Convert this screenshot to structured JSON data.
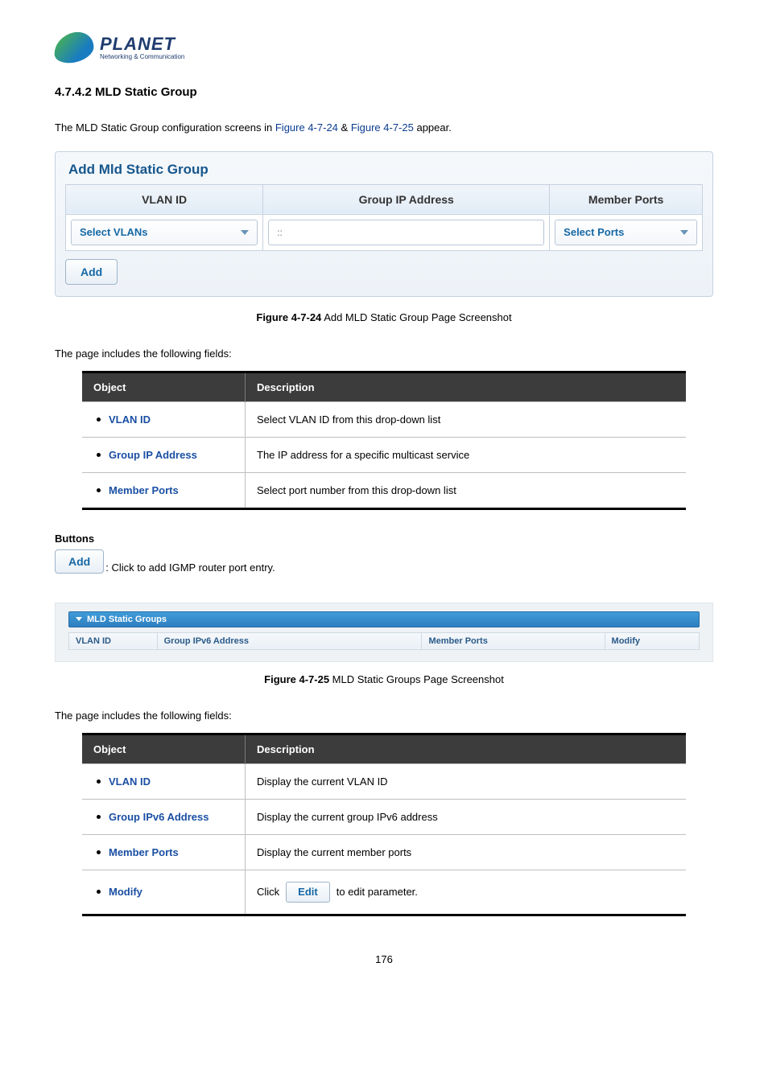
{
  "logo": {
    "title": "PLANET",
    "sub": "Networking & Communication"
  },
  "section": "4.7.4.2 MLD Static Group",
  "intro_pre": "The MLD Static Group configuration screens in ",
  "intro_link1": "Figure 4-7-24",
  "intro_amp": " & ",
  "intro_link2": "Figure 4-7-25",
  "intro_post": " appear.",
  "panel1": {
    "title": "Add Mld Static Group",
    "headers": {
      "vlan": "VLAN ID",
      "gip": "Group IP Address",
      "mports": "Member Ports"
    },
    "vlan_dropdown": "Select VLANs",
    "ip_placeholder": "::",
    "ports_dropdown": "Select Ports",
    "add_btn": "Add"
  },
  "caption1_bold": "Figure 4-7-24",
  "caption1_rest": " Add MLD Static Group Page Screenshot",
  "fields_intro": "The page includes the following fields:",
  "table1": {
    "h1": "Object",
    "h2": "Description",
    "rows": [
      {
        "obj": "VLAN ID",
        "desc": "Select VLAN ID from this drop-down list"
      },
      {
        "obj": "Group IP Address",
        "desc": "The IP address for a specific multicast service"
      },
      {
        "obj": "Member Ports",
        "desc": "Select port number from this drop-down list"
      }
    ]
  },
  "buttons_heading": "Buttons",
  "add_btn2": "Add",
  "add_btn2_after": ": Click to add IGMP router port entry.",
  "panel2": {
    "bar": "MLD Static Groups",
    "cols": {
      "c1": "VLAN ID",
      "c2": "Group IPv6 Address",
      "c3": "Member Ports",
      "c4": "Modify"
    }
  },
  "caption2_bold": "Figure 4-7-25",
  "caption2_rest": " MLD Static Groups Page Screenshot",
  "table2": {
    "h1": "Object",
    "h2": "Description",
    "rows": [
      {
        "obj": "VLAN ID",
        "desc": "Display the current VLAN ID"
      },
      {
        "obj": "Group IPv6 Address",
        "desc": "Display the current group IPv6 address"
      },
      {
        "obj": "Member Ports",
        "desc": "Display the current member ports"
      },
      {
        "obj": "Modify",
        "desc_pre": "Click ",
        "btn": "Edit",
        "desc_post": " to edit parameter."
      }
    ]
  },
  "page_num": "176"
}
